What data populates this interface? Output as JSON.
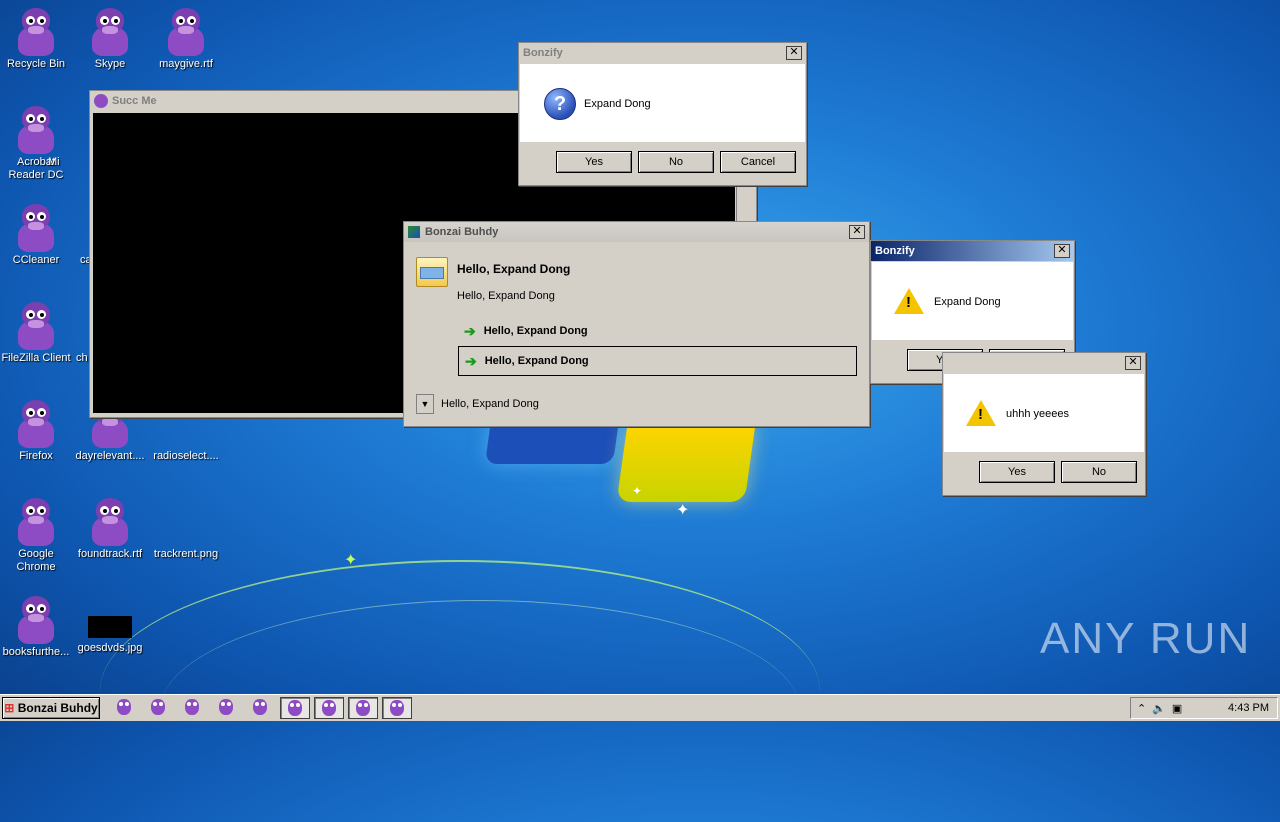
{
  "desktop": {
    "icons": [
      {
        "label": "Recycle Bin"
      },
      {
        "label": "Skype"
      },
      {
        "label": "maygive.rtf"
      },
      {
        "label": "Acrobat Reader DC"
      },
      {
        "label": "Mi"
      },
      {
        "label": "CCleaner"
      },
      {
        "label": "ca"
      },
      {
        "label": "FileZilla Client"
      },
      {
        "label": "ch"
      },
      {
        "label": "Firefox"
      },
      {
        "label": "dayrelevant...."
      },
      {
        "label": "radioselect...."
      },
      {
        "label": "Google Chrome"
      },
      {
        "label": "foundtrack.rtf"
      },
      {
        "label": "trackrent.png"
      },
      {
        "label": "booksfurthe..."
      },
      {
        "label": "goesdvds.jpg"
      }
    ]
  },
  "watermark": "ANY RUN",
  "succ_window": {
    "title": "Succ Me"
  },
  "bonzify_question": {
    "title": "Bonzify",
    "message": "Expand Dong",
    "buttons": {
      "yes": "Yes",
      "no": "No",
      "cancel": "Cancel"
    }
  },
  "bonzai_dialog": {
    "title": "Bonzai Buhdy",
    "heading": "Hello, Expand Dong",
    "subtext": "Hello, Expand Dong",
    "options": [
      "Hello, Expand Dong",
      "Hello, Expand Dong"
    ],
    "footer": "Hello, Expand Dong"
  },
  "bonzify_warning": {
    "title": "Bonzify",
    "message": "Expand Dong",
    "buttons": {
      "yes": "Yes",
      "no": "No"
    }
  },
  "uhhh_warning": {
    "message": "uhhh yeeees",
    "buttons": {
      "yes": "Yes",
      "no": "No"
    }
  },
  "taskbar": {
    "start_label": "Bonzai Buhdy",
    "task_count": 9,
    "clock": "4:43 PM"
  },
  "colors": {
    "wallpaper": "#1f7dd6",
    "dialog": "#d4d0c8",
    "gorilla": "#8e4cc4"
  }
}
